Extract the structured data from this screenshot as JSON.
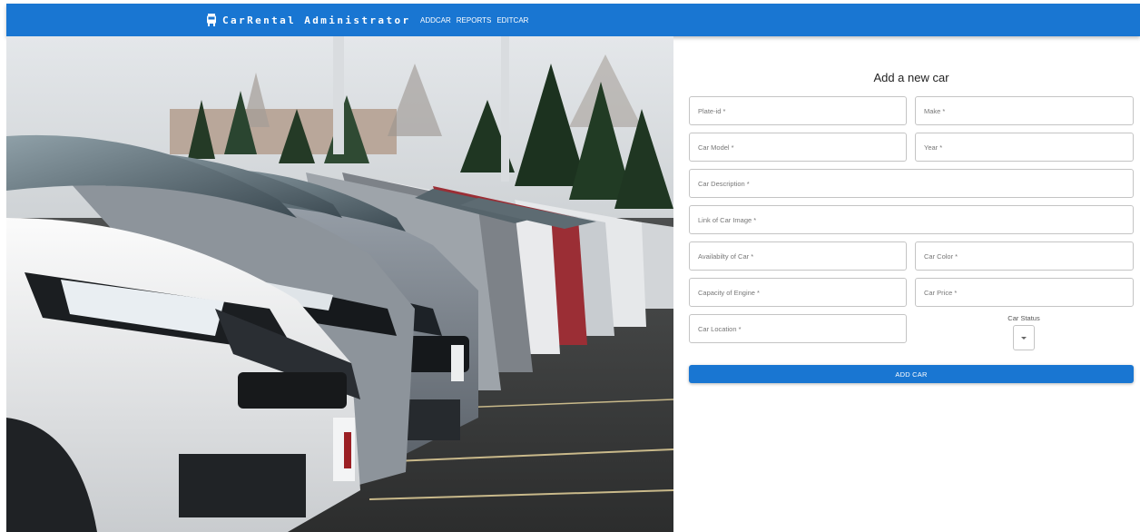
{
  "appbar": {
    "brand": "CarRental Administrator",
    "brand_icon": "car-icon",
    "nav": [
      "ADDCAR",
      "REPORTS",
      "EDITCAR"
    ],
    "color": "#1976d2"
  },
  "form": {
    "title": "Add a new car",
    "fields": {
      "plate_id": "Plate-id *",
      "make": "Make *",
      "car_model": "Car Model *",
      "year": "Year *",
      "car_description": "Car Description *",
      "car_image_link": "Link of Car Image *",
      "availability": "Availabilty of Car *",
      "car_color": "Car Color *",
      "engine_capacity": "Capacity of Engine *",
      "car_price": "Car Price *",
      "car_location": "Car Location *"
    },
    "status_label": "Car Status",
    "status_value": "",
    "submit_label": "ADD CAR"
  }
}
